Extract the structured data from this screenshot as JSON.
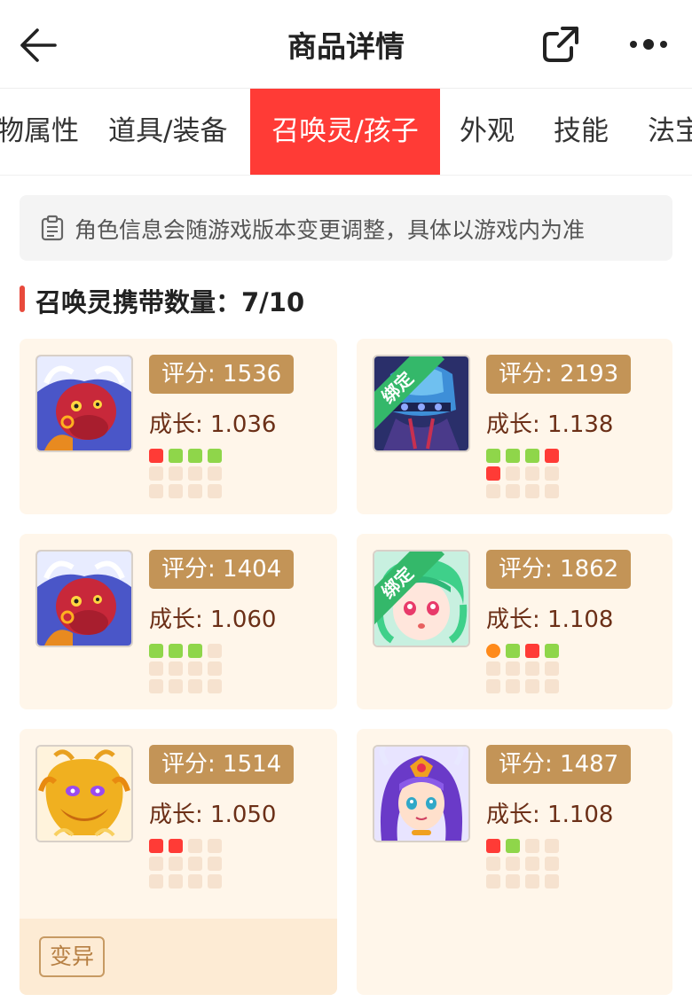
{
  "header": {
    "title": "商品详情",
    "back_icon": "arrow-left-icon",
    "share_icon": "share-icon",
    "more_icon": "more-dots-icon"
  },
  "tabs": [
    {
      "label": "物属性",
      "active": false
    },
    {
      "label": "道具/装备",
      "active": false
    },
    {
      "label": "召唤灵/孩子",
      "active": true
    },
    {
      "label": "外观",
      "active": false
    },
    {
      "label": "技能",
      "active": false
    },
    {
      "label": "法宝",
      "active": false
    }
  ],
  "notice": {
    "icon": "clipboard-icon",
    "text": "角色信息会随游戏版本变更调整，具体以游戏内为准"
  },
  "section": {
    "title": "召唤灵携带数量：7/10"
  },
  "colors": {
    "accent": "#ff3b36",
    "score_badge": "#c39457",
    "card_bg": "#fff6ea",
    "dot_red": "#ff3b36",
    "dot_green": "#8fd64a",
    "dot_orange": "#ff8a1a",
    "dot_empty": "#f6e2cf",
    "bound_green": "#34b86a"
  },
  "pets": [
    {
      "score": "评分: 1536",
      "growth": "成长: 1.036",
      "bound": false,
      "bound_label": "",
      "avatar": "red-bull-demon",
      "dots": [
        "red",
        "green",
        "green",
        "green",
        "empty",
        "empty",
        "empty",
        "empty",
        "empty",
        "empty",
        "empty",
        "empty"
      ],
      "variant": ""
    },
    {
      "score": "评分: 2193",
      "growth": "成长: 1.138",
      "bound": true,
      "bound_label": "绑定",
      "avatar": "blue-armored-warrior",
      "dots": [
        "green",
        "green",
        "green",
        "red",
        "red",
        "empty",
        "empty",
        "empty",
        "empty",
        "empty",
        "empty",
        "empty"
      ],
      "variant": ""
    },
    {
      "score": "评分: 1404",
      "growth": "成长: 1.060",
      "bound": false,
      "bound_label": "",
      "avatar": "red-bull-demon",
      "dots": [
        "green",
        "green",
        "green",
        "empty",
        "empty",
        "empty",
        "empty",
        "empty",
        "empty",
        "empty",
        "empty",
        "empty"
      ],
      "variant": ""
    },
    {
      "score": "评分: 1862",
      "growth": "成长: 1.108",
      "bound": true,
      "bound_label": "绑定",
      "avatar": "green-hair-girl",
      "dots": [
        "orange",
        "green",
        "red",
        "green",
        "empty",
        "empty",
        "empty",
        "empty",
        "empty",
        "empty",
        "empty",
        "empty"
      ],
      "variant": ""
    },
    {
      "score": "评分: 1514",
      "growth": "成长: 1.050",
      "bound": false,
      "bound_label": "",
      "avatar": "golden-dragon",
      "dots": [
        "red",
        "red",
        "empty",
        "empty",
        "empty",
        "empty",
        "empty",
        "empty",
        "empty",
        "empty",
        "empty",
        "empty"
      ],
      "variant": "变异"
    },
    {
      "score": "评分: 1487",
      "growth": "成长: 1.108",
      "bound": false,
      "bound_label": "",
      "avatar": "purple-hair-girl",
      "dots": [
        "red",
        "green",
        "empty",
        "empty",
        "empty",
        "empty",
        "empty",
        "empty",
        "empty",
        "empty",
        "empty",
        "empty"
      ],
      "variant": ""
    }
  ]
}
